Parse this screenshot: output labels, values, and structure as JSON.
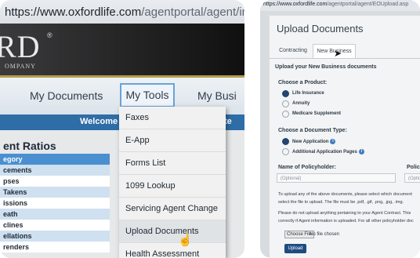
{
  "left_screen": {
    "url_prefix": "https://www.oxfordlife.com",
    "url_path": "/agentportal/agent/index.aspx",
    "logo_letters": "RD",
    "logo_registered": "®",
    "logo_company": "OMPANY",
    "nav": {
      "my_documents": "My Documents",
      "my_tools": "My Tools",
      "my_business_partial": "My Busi"
    },
    "welcome_text": "Welcome",
    "welcome_text_partial": "te",
    "ratios_title": "ent Ratios",
    "ratio_rows": [
      "egory",
      "cements",
      "pses",
      "Takens",
      "issions",
      "eath",
      "clines",
      "ellations",
      "renders"
    ],
    "menu_items": [
      "Faxes",
      "E-App",
      "Forms List",
      "1099 Lookup",
      "Servicing Agent Change",
      "Upload Documents",
      "Health Assessment"
    ],
    "hovered_item": "Upload Documents"
  },
  "right_screen": {
    "url_prefix": "https://www.oxfordlife.com",
    "url_path": "/agentportal/agent/EOUpload.asp",
    "title": "Upload Documents",
    "tabs": [
      "Contracting",
      "New Business"
    ],
    "active_tab": "New Business",
    "section_heading": "Upload your New Business documents",
    "product_label": "Choose a Product:",
    "products": [
      {
        "label": "Life Insurance",
        "selected": true
      },
      {
        "label": "Annuity",
        "selected": false
      },
      {
        "label": "Medicare Supplement",
        "selected": false
      }
    ],
    "doc_type_label": "Choose a Document Type:",
    "doc_types": [
      {
        "label": "New Application",
        "selected": true
      },
      {
        "label": "Additional Application Pages",
        "selected": false
      }
    ],
    "policyholder_label": "Name of Policyholder:",
    "policy_label_partial": "Polic",
    "policyholder_placeholder": "(Optional)",
    "policy_placeholder_partial": "(Optio",
    "instructions_1a": "To upload any of the above documents, please select which document",
    "instructions_1b": "select the file to upload. The file must be .pdf, .gif, .png, .jpg, .img.",
    "instructions_2a": "Please do not upload anything pertaining to your Agent Contract. This",
    "instructions_2b": "correctly if Agent information is uploaded. For all other policyholder doc",
    "choose_file": "Choose File",
    "no_file": "No file chosen",
    "upload_button": "Upload"
  },
  "colors": {
    "welcome_bar": "#2f6da7",
    "nav_highlight_border": "#6aa3d6",
    "upload_button": "#1e4c82",
    "radio_selected": "#23456e"
  }
}
